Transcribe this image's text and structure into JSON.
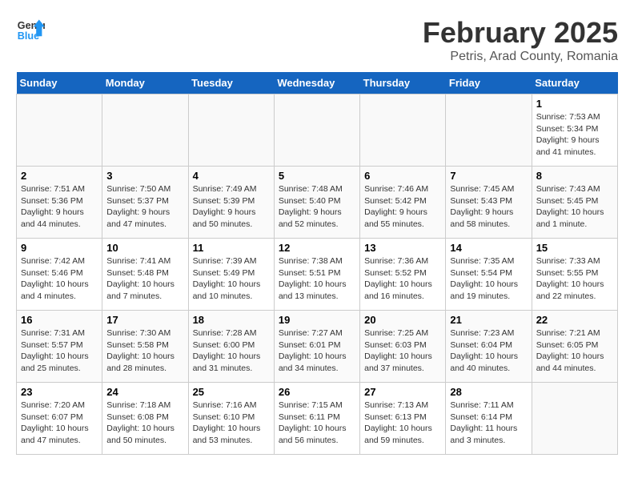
{
  "header": {
    "logo_line1": "General",
    "logo_line2": "Blue",
    "title": "February 2025",
    "subtitle": "Petris, Arad County, Romania"
  },
  "weekdays": [
    "Sunday",
    "Monday",
    "Tuesday",
    "Wednesday",
    "Thursday",
    "Friday",
    "Saturday"
  ],
  "weeks": [
    [
      {
        "day": "",
        "info": ""
      },
      {
        "day": "",
        "info": ""
      },
      {
        "day": "",
        "info": ""
      },
      {
        "day": "",
        "info": ""
      },
      {
        "day": "",
        "info": ""
      },
      {
        "day": "",
        "info": ""
      },
      {
        "day": "1",
        "info": "Sunrise: 7:53 AM\nSunset: 5:34 PM\nDaylight: 9 hours and 41 minutes."
      }
    ],
    [
      {
        "day": "2",
        "info": "Sunrise: 7:51 AM\nSunset: 5:36 PM\nDaylight: 9 hours and 44 minutes."
      },
      {
        "day": "3",
        "info": "Sunrise: 7:50 AM\nSunset: 5:37 PM\nDaylight: 9 hours and 47 minutes."
      },
      {
        "day": "4",
        "info": "Sunrise: 7:49 AM\nSunset: 5:39 PM\nDaylight: 9 hours and 50 minutes."
      },
      {
        "day": "5",
        "info": "Sunrise: 7:48 AM\nSunset: 5:40 PM\nDaylight: 9 hours and 52 minutes."
      },
      {
        "day": "6",
        "info": "Sunrise: 7:46 AM\nSunset: 5:42 PM\nDaylight: 9 hours and 55 minutes."
      },
      {
        "day": "7",
        "info": "Sunrise: 7:45 AM\nSunset: 5:43 PM\nDaylight: 9 hours and 58 minutes."
      },
      {
        "day": "8",
        "info": "Sunrise: 7:43 AM\nSunset: 5:45 PM\nDaylight: 10 hours and 1 minute."
      }
    ],
    [
      {
        "day": "9",
        "info": "Sunrise: 7:42 AM\nSunset: 5:46 PM\nDaylight: 10 hours and 4 minutes."
      },
      {
        "day": "10",
        "info": "Sunrise: 7:41 AM\nSunset: 5:48 PM\nDaylight: 10 hours and 7 minutes."
      },
      {
        "day": "11",
        "info": "Sunrise: 7:39 AM\nSunset: 5:49 PM\nDaylight: 10 hours and 10 minutes."
      },
      {
        "day": "12",
        "info": "Sunrise: 7:38 AM\nSunset: 5:51 PM\nDaylight: 10 hours and 13 minutes."
      },
      {
        "day": "13",
        "info": "Sunrise: 7:36 AM\nSunset: 5:52 PM\nDaylight: 10 hours and 16 minutes."
      },
      {
        "day": "14",
        "info": "Sunrise: 7:35 AM\nSunset: 5:54 PM\nDaylight: 10 hours and 19 minutes."
      },
      {
        "day": "15",
        "info": "Sunrise: 7:33 AM\nSunset: 5:55 PM\nDaylight: 10 hours and 22 minutes."
      }
    ],
    [
      {
        "day": "16",
        "info": "Sunrise: 7:31 AM\nSunset: 5:57 PM\nDaylight: 10 hours and 25 minutes."
      },
      {
        "day": "17",
        "info": "Sunrise: 7:30 AM\nSunset: 5:58 PM\nDaylight: 10 hours and 28 minutes."
      },
      {
        "day": "18",
        "info": "Sunrise: 7:28 AM\nSunset: 6:00 PM\nDaylight: 10 hours and 31 minutes."
      },
      {
        "day": "19",
        "info": "Sunrise: 7:27 AM\nSunset: 6:01 PM\nDaylight: 10 hours and 34 minutes."
      },
      {
        "day": "20",
        "info": "Sunrise: 7:25 AM\nSunset: 6:03 PM\nDaylight: 10 hours and 37 minutes."
      },
      {
        "day": "21",
        "info": "Sunrise: 7:23 AM\nSunset: 6:04 PM\nDaylight: 10 hours and 40 minutes."
      },
      {
        "day": "22",
        "info": "Sunrise: 7:21 AM\nSunset: 6:05 PM\nDaylight: 10 hours and 44 minutes."
      }
    ],
    [
      {
        "day": "23",
        "info": "Sunrise: 7:20 AM\nSunset: 6:07 PM\nDaylight: 10 hours and 47 minutes."
      },
      {
        "day": "24",
        "info": "Sunrise: 7:18 AM\nSunset: 6:08 PM\nDaylight: 10 hours and 50 minutes."
      },
      {
        "day": "25",
        "info": "Sunrise: 7:16 AM\nSunset: 6:10 PM\nDaylight: 10 hours and 53 minutes."
      },
      {
        "day": "26",
        "info": "Sunrise: 7:15 AM\nSunset: 6:11 PM\nDaylight: 10 hours and 56 minutes."
      },
      {
        "day": "27",
        "info": "Sunrise: 7:13 AM\nSunset: 6:13 PM\nDaylight: 10 hours and 59 minutes."
      },
      {
        "day": "28",
        "info": "Sunrise: 7:11 AM\nSunset: 6:14 PM\nDaylight: 11 hours and 3 minutes."
      },
      {
        "day": "",
        "info": ""
      }
    ]
  ]
}
